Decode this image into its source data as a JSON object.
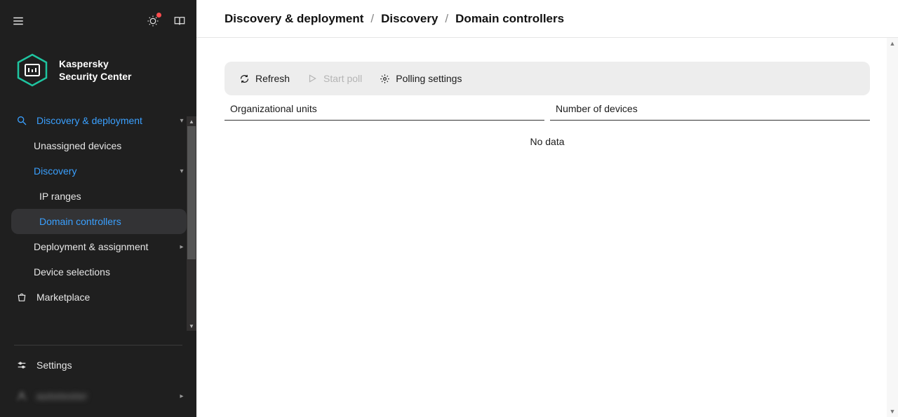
{
  "app": {
    "title1": "Kaspersky",
    "title2": "Security Center"
  },
  "sidebar": {
    "items": [
      {
        "label": "Discovery & deployment"
      },
      {
        "label": "Unassigned devices"
      },
      {
        "label": "Discovery"
      },
      {
        "label": "IP ranges"
      },
      {
        "label": "Domain controllers"
      },
      {
        "label": "Deployment & assignment"
      },
      {
        "label": "Device selections"
      },
      {
        "label": "Marketplace"
      }
    ],
    "settings": "Settings",
    "user": "autotester"
  },
  "breadcrumbs": {
    "a": "Discovery & deployment",
    "b": "Discovery",
    "c": "Domain controllers"
  },
  "toolbar": {
    "refresh": "Refresh",
    "start_poll": "Start poll",
    "polling_settings": "Polling settings"
  },
  "table": {
    "col_ou": "Organizational units",
    "col_devices": "Number of devices",
    "nodata": "No data"
  }
}
